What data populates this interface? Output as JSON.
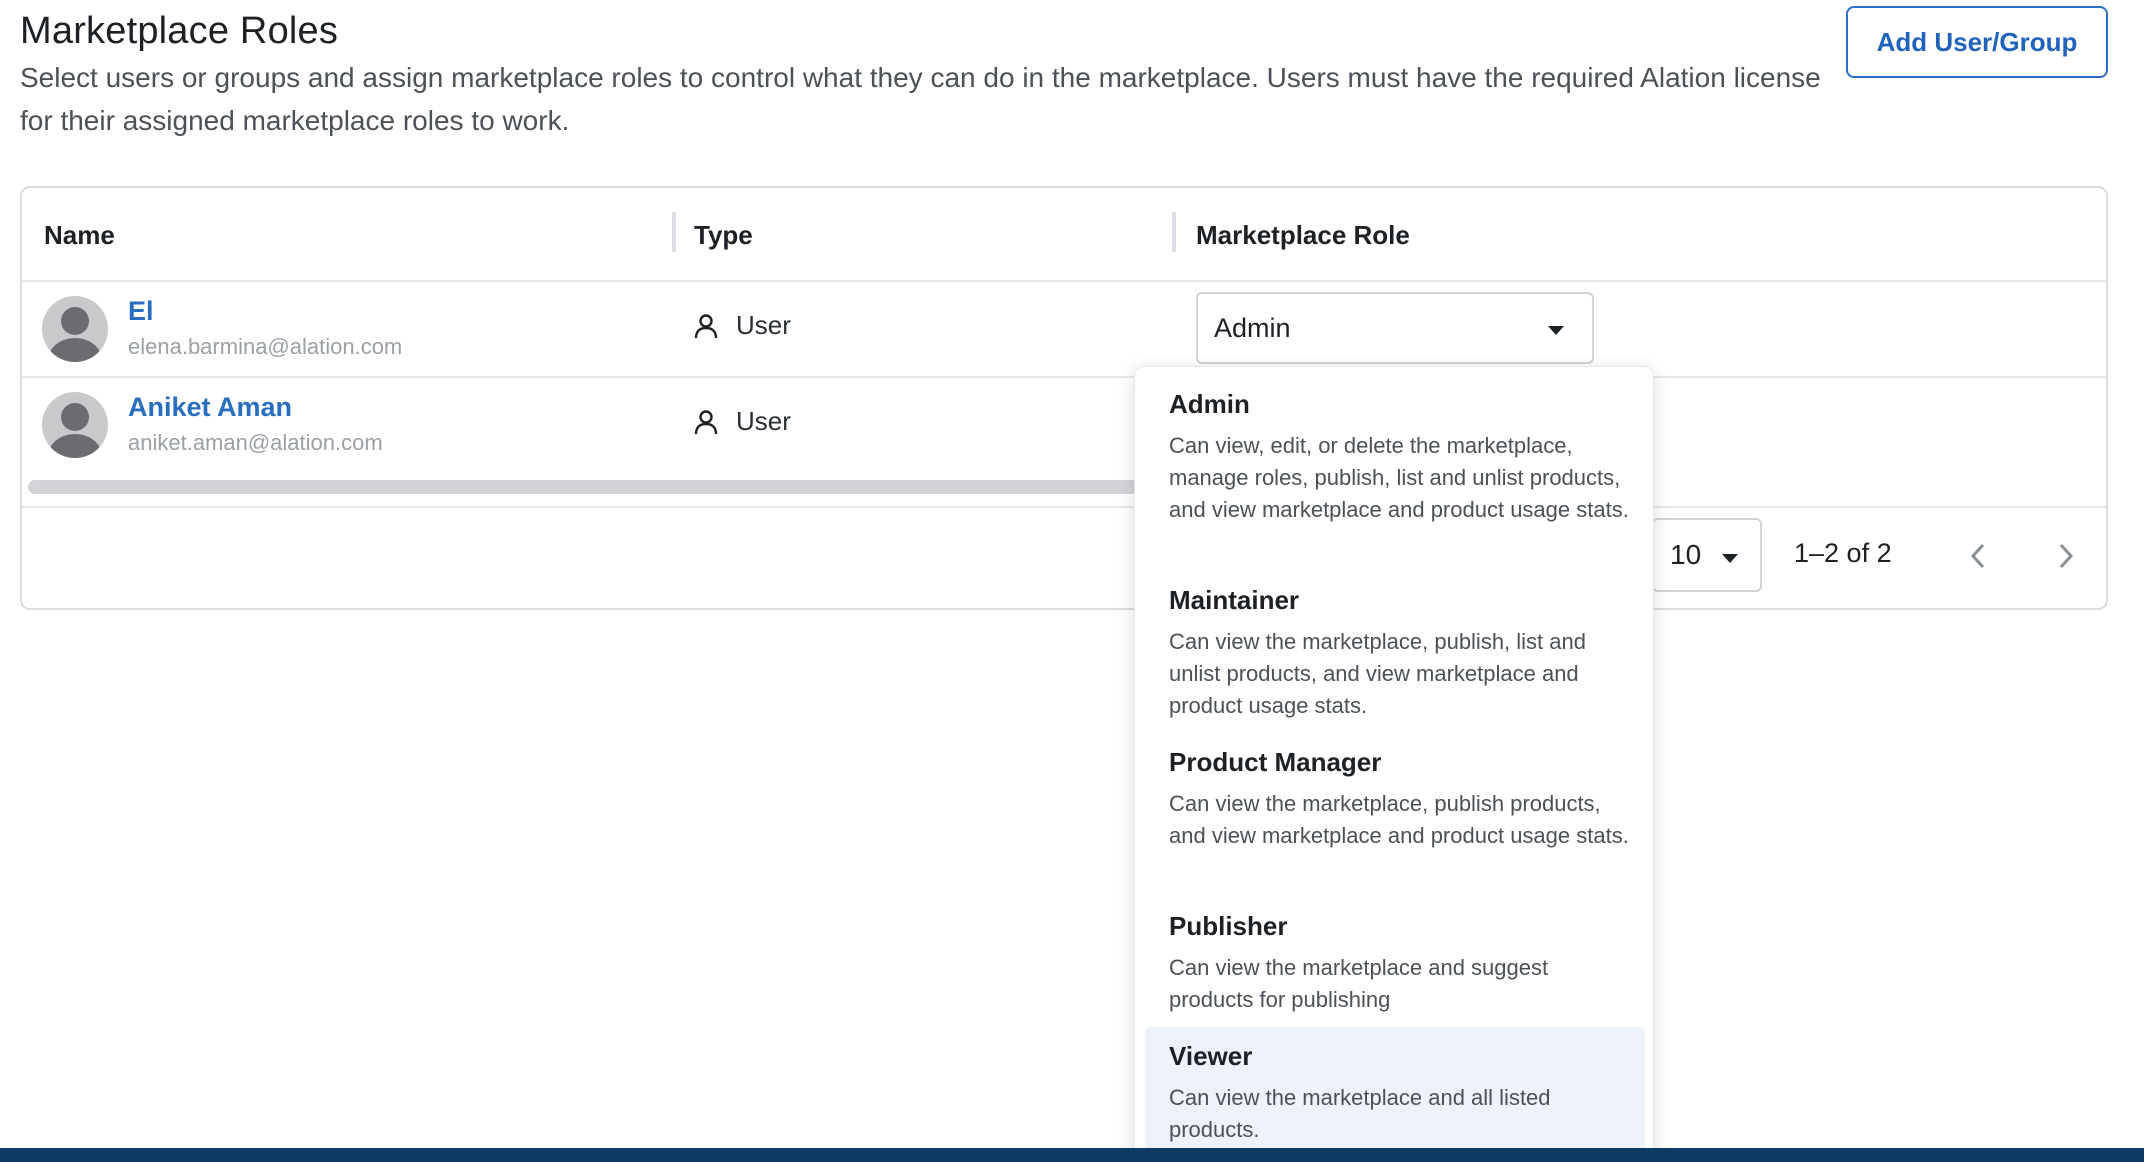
{
  "header": {
    "title": "Marketplace Roles",
    "description": "Select users or groups and assign marketplace roles to control what they can do in the marketplace. Users must have the required Alation license for their assigned marketplace roles to work.",
    "add_button_label": "Add User/Group"
  },
  "table": {
    "columns": [
      "Name",
      "Type",
      "Marketplace Role"
    ],
    "rows": [
      {
        "name": "El",
        "email": "elena.barmina@alation.com",
        "type": "User",
        "role": "Admin"
      },
      {
        "name": "Aniket Aman",
        "email": "aniket.aman@alation.com",
        "type": "User",
        "role": ""
      }
    ]
  },
  "pagination": {
    "page_size": "10",
    "range": "1–2 of 2"
  },
  "role_dropdown": {
    "options": [
      {
        "title": "Admin",
        "description": "Can view, edit, or delete the marketplace, manage roles, publish, list and unlist products, and view marketplace and product usage stats."
      },
      {
        "title": "Maintainer",
        "description": "Can view the marketplace, publish, list and unlist products, and view marketplace and product usage stats."
      },
      {
        "title": "Product Manager",
        "description": "Can view the marketplace, publish products, and view marketplace and product usage stats."
      },
      {
        "title": "Publisher",
        "description": "Can view the marketplace and suggest products for publishing"
      },
      {
        "title": "Viewer",
        "description": "Can view the marketplace and all listed products."
      }
    ],
    "highlighted": "Viewer"
  },
  "colors": {
    "accent": "#2a6ebf",
    "bottom_band": "#0e3a66",
    "highlight": "#edf2fb"
  },
  "icons": [
    "user-icon",
    "chevron-down-icon",
    "chevron-left-icon",
    "chevron-right-icon",
    "avatar-placeholder-icon"
  ]
}
